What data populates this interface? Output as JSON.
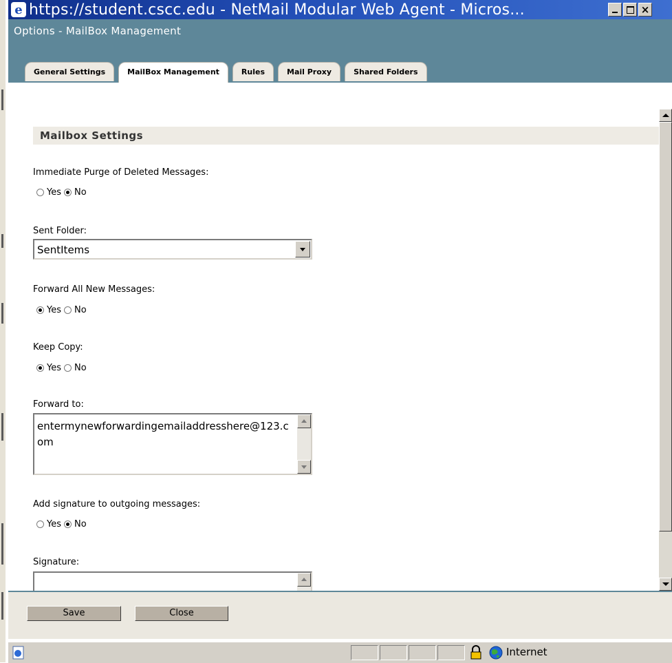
{
  "window": {
    "title": "https://student.cscc.edu - NetMail Modular Web Agent - Micros...",
    "app_icon": "ie-icon",
    "controls": [
      "minimize",
      "maximize",
      "close"
    ]
  },
  "header": {
    "page_title": "Options - MailBox Management",
    "tabs": [
      {
        "label": "General Settings",
        "active": false
      },
      {
        "label": "MailBox Management",
        "active": true
      },
      {
        "label": "Rules",
        "active": false
      },
      {
        "label": "Mail Proxy",
        "active": false
      },
      {
        "label": "Shared Folders",
        "active": false
      }
    ]
  },
  "section": {
    "title": "Mailbox Settings"
  },
  "fields": {
    "purge": {
      "label": "Immediate Purge of Deleted Messages:",
      "yes": "Yes",
      "no": "No",
      "selected": "No"
    },
    "sent_folder": {
      "label": "Sent Folder:",
      "value": "SentItems"
    },
    "forward_all": {
      "label": "Forward All New Messages:",
      "yes": "Yes",
      "no": "No",
      "selected": "Yes"
    },
    "keep_copy": {
      "label": "Keep Copy:",
      "yes": "Yes",
      "no": "No",
      "selected": "Yes"
    },
    "forward_to": {
      "label": "Forward to:",
      "value": "entermynewforwardingemailaddresshere@123.com"
    },
    "add_signature": {
      "label": "Add signature to outgoing messages:",
      "yes": "Yes",
      "no": "No",
      "selected": "No"
    },
    "signature": {
      "label": "Signature:",
      "value": ""
    }
  },
  "buttons": {
    "save": "Save",
    "close": "Close"
  },
  "statusbar": {
    "zone": "Internet",
    "icons": [
      "page-icon",
      "lock-icon",
      "globe-icon"
    ]
  },
  "colors": {
    "title_bar": "#1c46b0",
    "header_bg": "#5e8799",
    "section_bg": "#eeebe4",
    "button_bg": "#b8b0a4"
  }
}
